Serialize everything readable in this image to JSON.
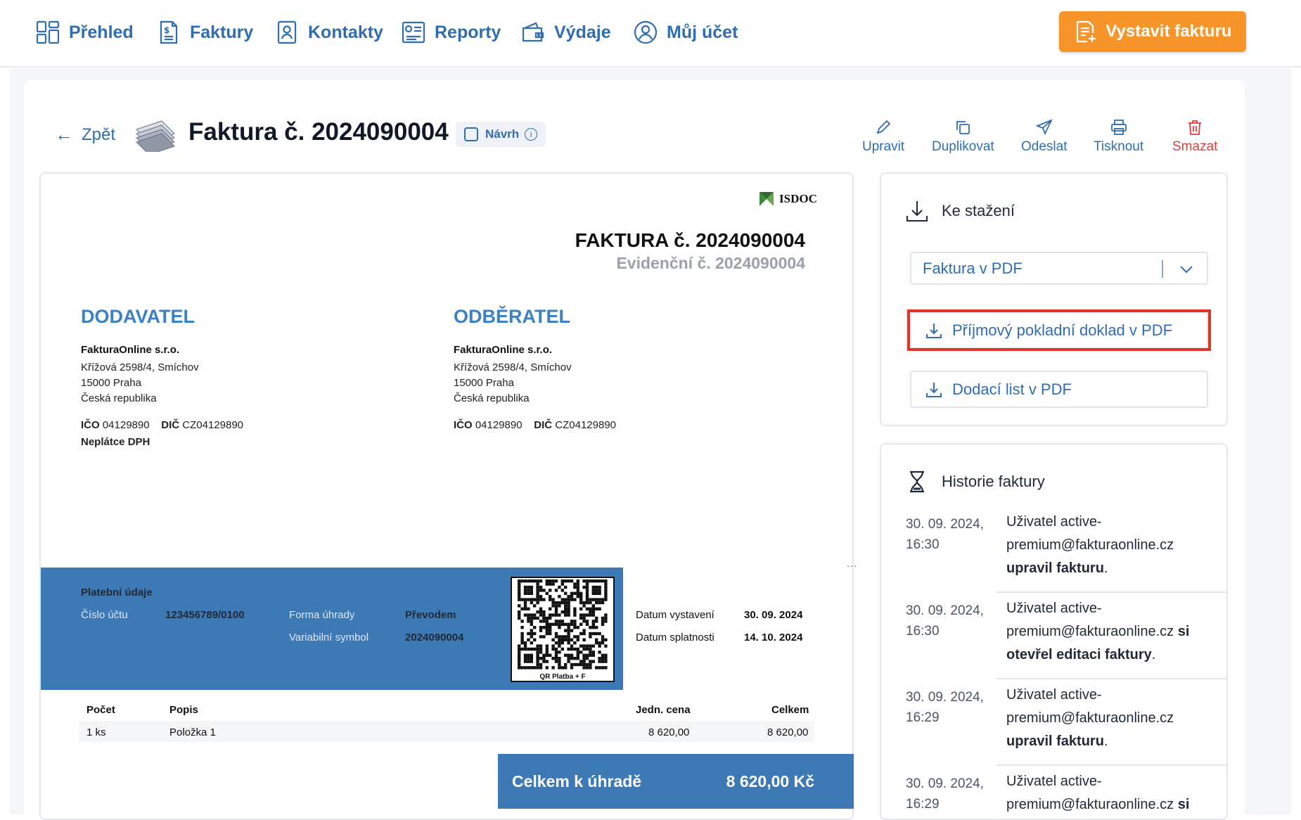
{
  "nav": {
    "items": [
      {
        "label": "Přehled",
        "icon": "dashboard-icon"
      },
      {
        "label": "Faktury",
        "icon": "invoice-icon"
      },
      {
        "label": "Kontakty",
        "icon": "contacts-icon"
      },
      {
        "label": "Reporty",
        "icon": "reports-icon"
      },
      {
        "label": "Výdaje",
        "icon": "wallet-icon"
      },
      {
        "label": "Můj účet",
        "icon": "user-icon"
      }
    ],
    "cta_label": "Vystavit fakturu"
  },
  "header": {
    "back_label": "Zpět",
    "title": "Faktura č. 2024090004",
    "status_badge": "Návrh",
    "actions": [
      {
        "label": "Upravit",
        "icon": "pencil-icon"
      },
      {
        "label": "Duplikovat",
        "icon": "duplicate-icon"
      },
      {
        "label": "Odeslat",
        "icon": "send-icon"
      },
      {
        "label": "Tisknout",
        "icon": "printer-icon"
      },
      {
        "label": "Smazat",
        "icon": "trash-icon"
      }
    ]
  },
  "invoice": {
    "isdoc_label": "ISDOC",
    "title": "FAKTURA č. 2024090004",
    "evidence": "Evidenční č. 2024090004",
    "supplier": {
      "heading": "DODAVATEL",
      "name": "FakturaOnline s.r.o.",
      "street": "Křížová 2598/4, Smíchov",
      "city": "15000 Praha",
      "country": "Česká republika",
      "ico_label": "IČO",
      "ico": "04129890",
      "dic_label": "DIČ",
      "dic": "CZ04129890",
      "vat_note": "Neplátce DPH"
    },
    "customer": {
      "heading": "ODBĚRATEL",
      "name": "FakturaOnline s.r.o.",
      "street": "Křížová 2598/4, Smíchov",
      "city": "15000 Praha",
      "country": "Česká republika",
      "ico_label": "IČO",
      "ico": "04129890",
      "dic_label": "DIČ",
      "dic": "CZ04129890"
    },
    "payment": {
      "heading": "Platební údaje",
      "account_label": "Číslo účtu",
      "account": "123456789/0100",
      "method_label": "Forma úhrady",
      "method": "Převodem",
      "vs_label": "Variabilní symbol",
      "vs": "2024090004",
      "qr_caption": "QR Platba + F"
    },
    "dates": {
      "issued_label": "Datum vystavení",
      "issued": "30. 09. 2024",
      "due_label": "Datum splatnosti",
      "due": "14. 10. 2024"
    },
    "items_header": {
      "qty": "Počet",
      "desc": "Popis",
      "unit": "Jedn. cena",
      "total": "Celkem"
    },
    "items": [
      {
        "qty": "1 ks",
        "desc": "Položka 1",
        "unit": "8 620,00",
        "total": "8 620,00"
      }
    ],
    "total_label": "Celkem k úhradě",
    "total_value": "8 620,00 Kč"
  },
  "downloads": {
    "heading": "Ke stažení",
    "select_value": "Faktura v PDF",
    "buttons": [
      "Příjmový pokladní doklad v PDF",
      "Dodací list v PDF"
    ]
  },
  "history": {
    "heading": "Historie faktury",
    "entries": [
      {
        "date": "30. 09. 2024, 16:30",
        "user": "Uživatel active-premium@fakturaonline.cz",
        "action_pre": "",
        "action": "upravil fakturu",
        "suffix": "."
      },
      {
        "date": "30. 09. 2024, 16:30",
        "user": "Uživatel active-premium@fakturaonline.cz",
        "action_pre": "si",
        "action": "otevřel editaci faktury",
        "suffix": "."
      },
      {
        "date": "30. 09. 2024, 16:29",
        "user": "Uživatel active-premium@fakturaonline.cz",
        "action_pre": "",
        "action": "upravil fakturu",
        "suffix": "."
      },
      {
        "date": "30. 09. 2024, 16:29",
        "user": "Uživatel active-premium@fakturaonline.cz",
        "action_pre": "si",
        "action": "",
        "suffix": ""
      }
    ]
  },
  "colors": {
    "brand": "#2f6db0",
    "accent": "#f7952b",
    "danger": "#e23b3b",
    "band": "#3d79b5",
    "highlight": "#e03526"
  }
}
